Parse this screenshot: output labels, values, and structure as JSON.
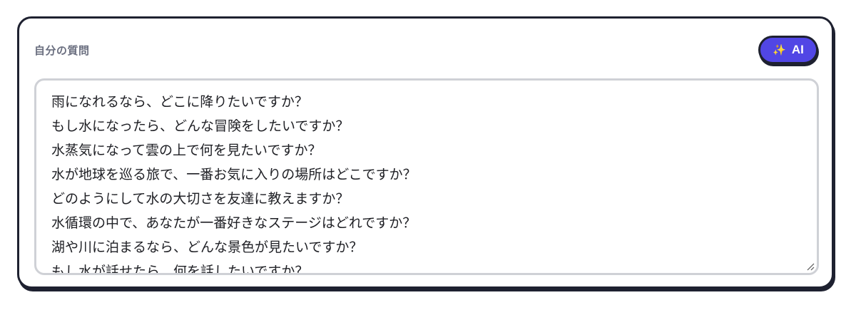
{
  "panel": {
    "label": "自分の質問",
    "ai_button": {
      "icon": "sparkle-icon",
      "label": "AI",
      "color": "#5146e5"
    }
  },
  "questions": [
    "雨になれるなら、どこに降りたいですか？",
    "もし水になったら、どんな冒険をしたいですか？",
    "水蒸気になって雲の上で何を見たいですか？",
    "水が地球を巡る旅で、一番お気に入りの場所はどこですか？",
    "どのようにして水の大切さを友達に教えますか？",
    "水循環の中で、あなたが一番好きなステージはどれですか？",
    "湖や川に泊まるなら、どんな景色が見たいですか？",
    "もし水が話せたら、何を話したいですか？"
  ]
}
